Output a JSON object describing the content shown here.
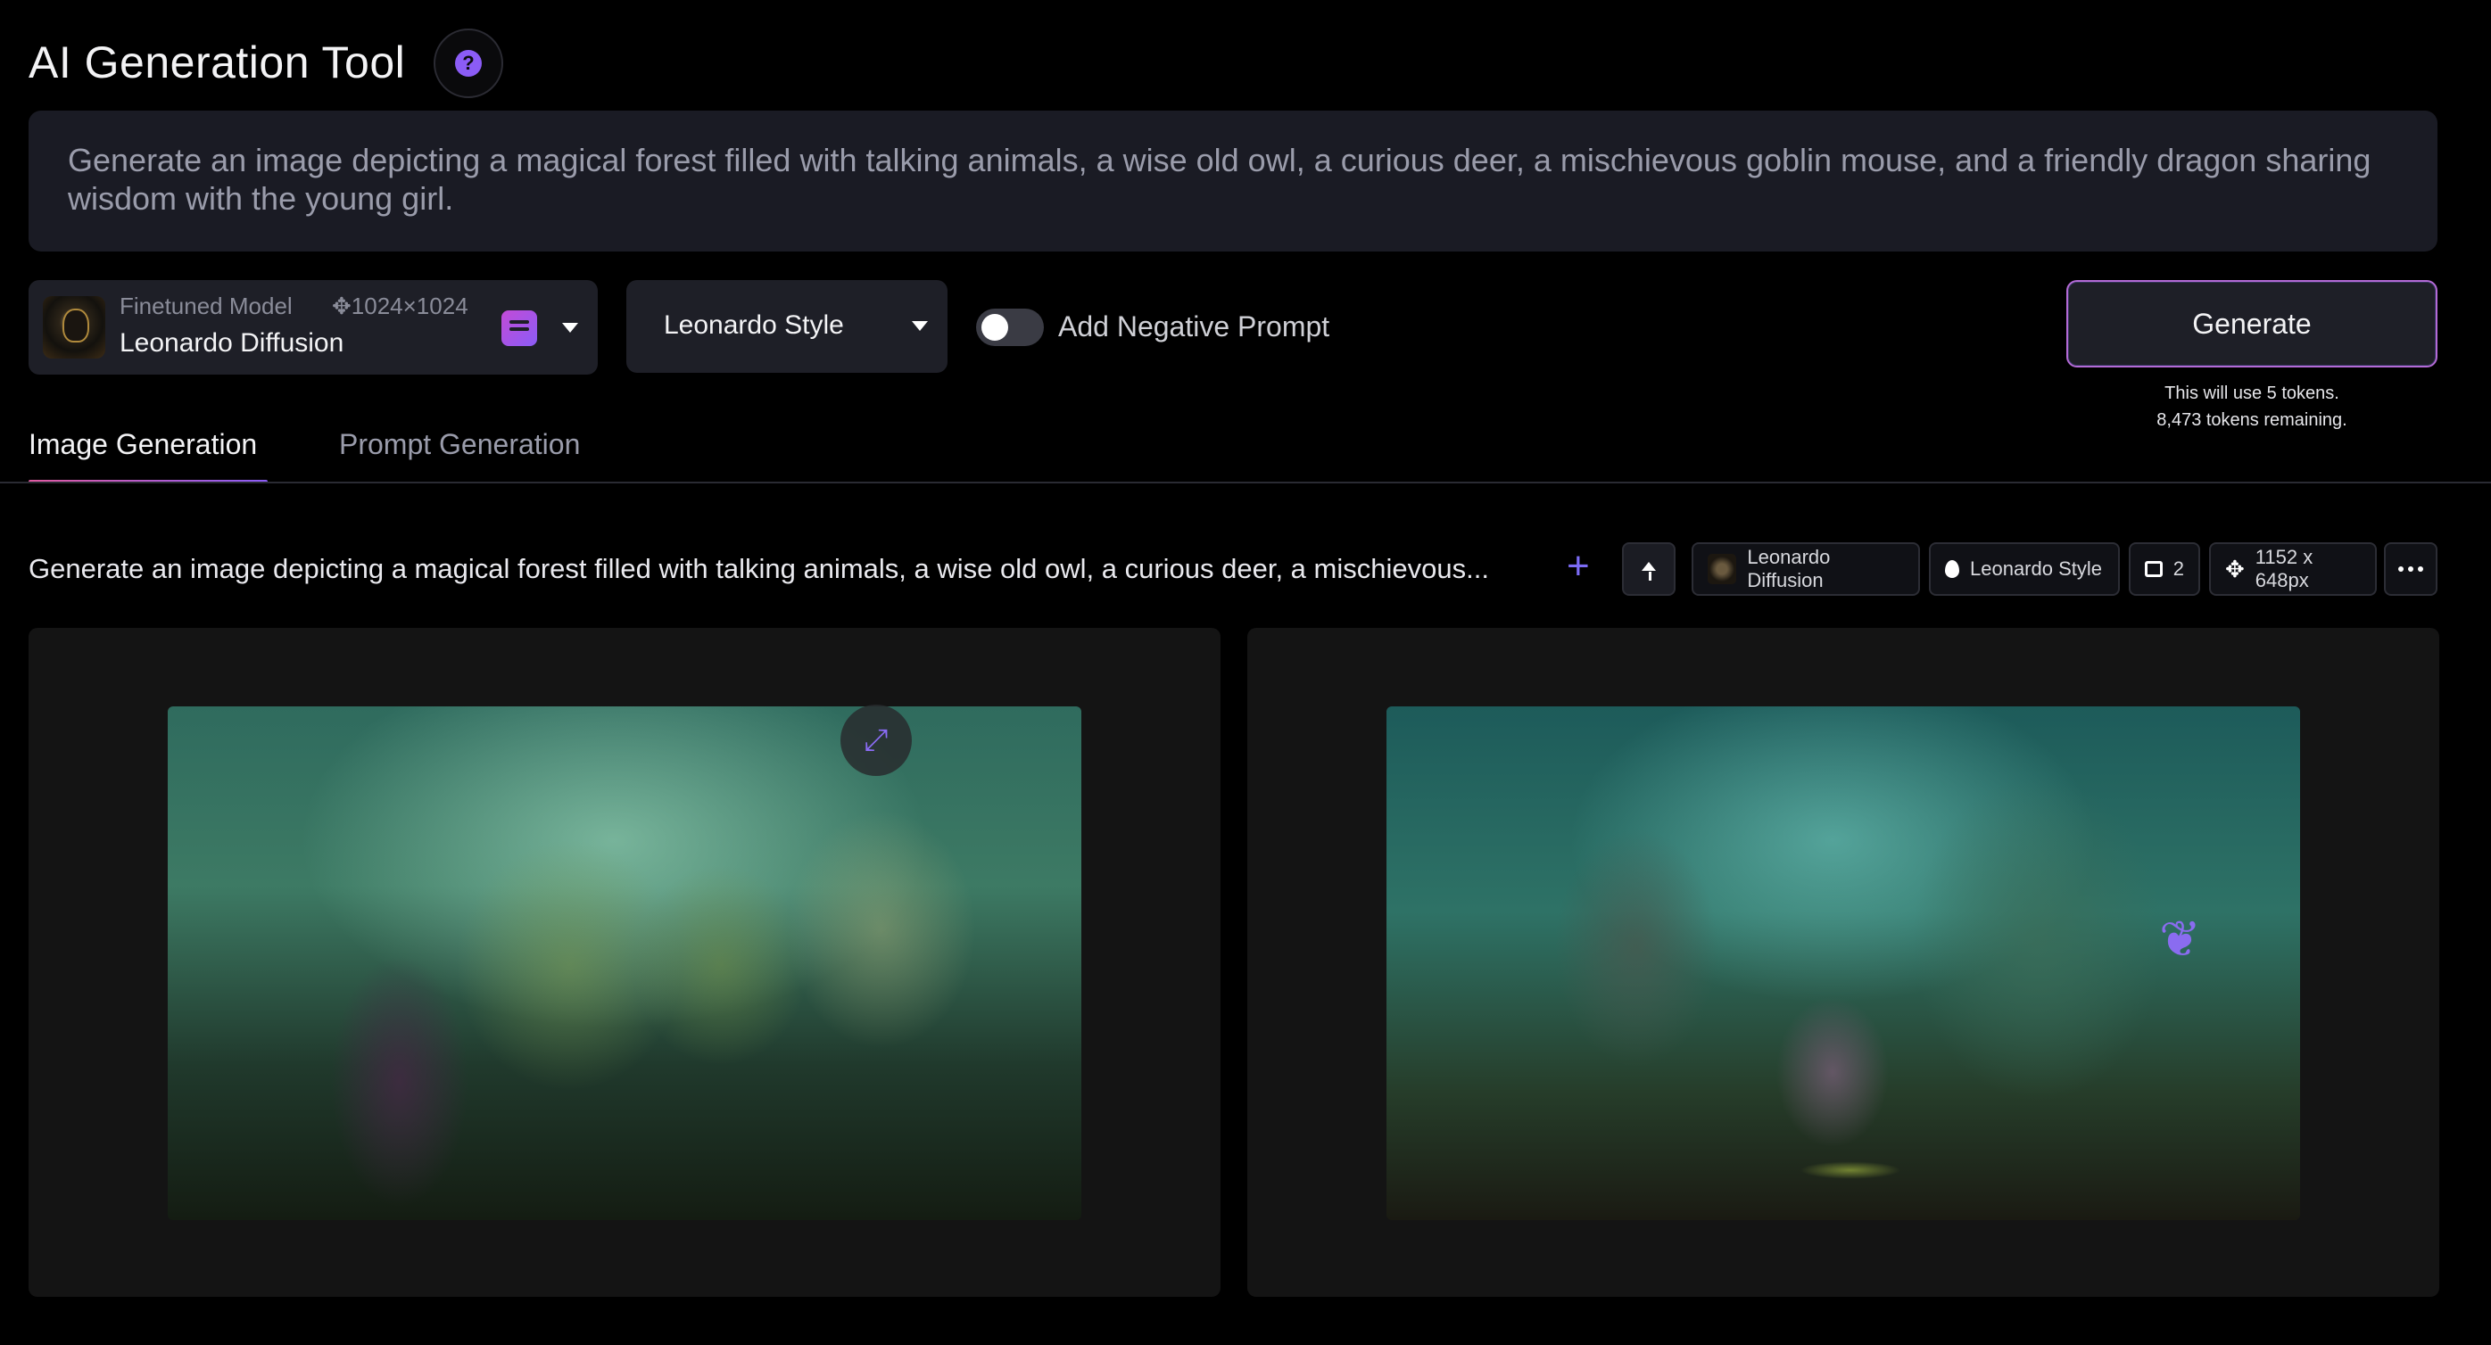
{
  "header": {
    "title": "AI Generation Tool",
    "help_icon": "question-circle-icon"
  },
  "prompt": {
    "text": "Generate an image depicting a magical forest filled with talking animals, a wise old owl, a curious deer, a mischievous goblin mouse, and a friendly dragon sharing wisdom with the young girl."
  },
  "model": {
    "label": "Finetuned Model",
    "resolution": "✥1024×1024",
    "name": "Leonardo Diffusion"
  },
  "style": {
    "selected": "Leonardo Style"
  },
  "negative_prompt": {
    "label": "Add Negative Prompt",
    "enabled": false
  },
  "generate": {
    "label": "Generate",
    "token_cost": "This will use 5 tokens.",
    "tokens_remaining": "8,473 tokens remaining."
  },
  "tabs": [
    {
      "label": "Image Generation",
      "active": true
    },
    {
      "label": "Prompt Generation",
      "active": false
    }
  ],
  "generation": {
    "prompt_preview": "Generate an image depicting a magical forest filled with talking animals, a wise old owl, a curious deer, a mischievous...",
    "model": "Leonardo Diffusion",
    "style": "Leonardo Style",
    "count": "2",
    "size": "1152 x 648px"
  },
  "colors": {
    "accent": "#8b5cf6",
    "background": "#000000",
    "panel": "#141414",
    "input": "#1a1b24"
  }
}
